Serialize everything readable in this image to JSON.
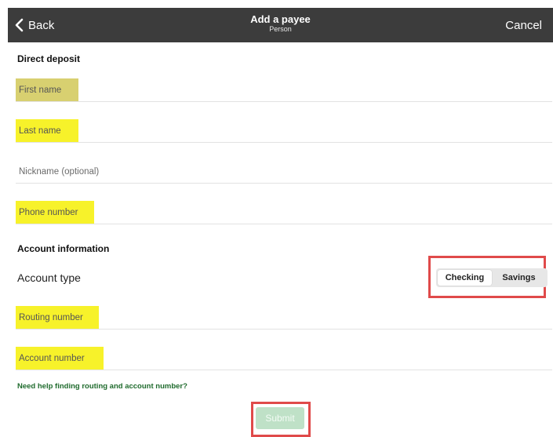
{
  "header": {
    "back_label": "Back",
    "title": "Add a payee",
    "subtitle": "Person",
    "cancel_label": "Cancel",
    "background_color": "#3c3c3c"
  },
  "sections": {
    "direct_deposit": "Direct deposit",
    "account_information": "Account information"
  },
  "fields": {
    "first_name": {
      "value": "",
      "placeholder": "First name",
      "highlighted": true
    },
    "last_name": {
      "value": "",
      "placeholder": "Last name",
      "highlighted": true
    },
    "nickname": {
      "value": "",
      "placeholder": "Nickname (optional)",
      "highlighted": false
    },
    "phone_number": {
      "value": "",
      "placeholder": "Phone number",
      "highlighted": true
    },
    "routing_number": {
      "value": "",
      "placeholder": "Routing number",
      "highlighted": true
    },
    "account_number": {
      "value": "",
      "placeholder": "Account number",
      "highlighted": true
    }
  },
  "account_type": {
    "label": "Account type",
    "options": [
      "Checking",
      "Savings"
    ],
    "selected": "Checking"
  },
  "help_link": "Need help finding routing and account number?",
  "submit_label": "Submit",
  "colors": {
    "highlight": "#f7f22a",
    "annotation_box": "#e04a4a",
    "link": "#1f6b2d",
    "submit_disabled": "#bfe1c7"
  },
  "icons": {
    "back": "chevron-left-icon"
  }
}
